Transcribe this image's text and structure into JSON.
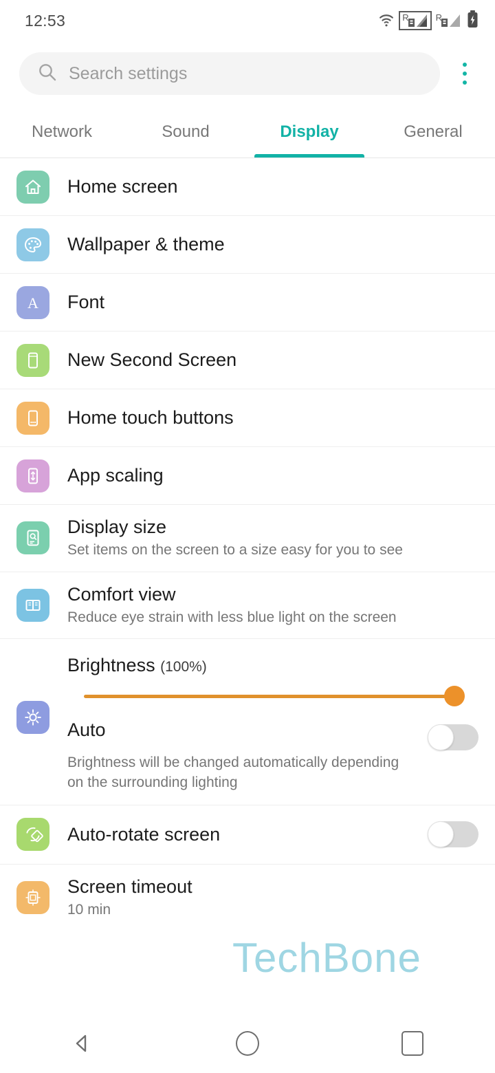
{
  "status_bar": {
    "time": "12:53",
    "icons": [
      "wifi-icon",
      "signal-roaming-sim1-icon",
      "signal-roaming-sim2-icon",
      "battery-charging-icon"
    ],
    "roaming_label": "R"
  },
  "search": {
    "placeholder": "Search settings",
    "icon": "search-icon",
    "overflow_icon": "more-vertical-icon"
  },
  "tabs": [
    {
      "label": "Network",
      "active": false
    },
    {
      "label": "Sound",
      "active": false
    },
    {
      "label": "Display",
      "active": true
    },
    {
      "label": "General",
      "active": false
    }
  ],
  "accent_color": "#12b2a6",
  "slider_color": "#ec912a",
  "settings": [
    {
      "title": "Home screen",
      "subtitle": "",
      "icon": "home-icon",
      "icon_color": "#7ecdaf",
      "control": "none"
    },
    {
      "title": "Wallpaper & theme",
      "subtitle": "",
      "icon": "palette-icon",
      "icon_color": "#8ec9e6",
      "control": "none"
    },
    {
      "title": "Font",
      "subtitle": "",
      "icon": "font-letter-a-icon",
      "icon_color": "#9aa7e0",
      "control": "none"
    },
    {
      "title": "New Second Screen",
      "subtitle": "",
      "icon": "phone-screen-icon",
      "icon_color": "#a8da78",
      "control": "none"
    },
    {
      "title": "Home touch buttons",
      "subtitle": "",
      "icon": "phone-buttons-icon",
      "icon_color": "#f4b868",
      "control": "none"
    },
    {
      "title": "App scaling",
      "subtitle": "",
      "icon": "phone-resize-icon",
      "icon_color": "#d7a3d9",
      "control": "none"
    },
    {
      "title": "Display size",
      "subtitle": "Set items on the screen to a size easy for you to see",
      "icon": "display-size-icon",
      "icon_color": "#7bcfae",
      "control": "none"
    },
    {
      "title": "Comfort view",
      "subtitle": "Reduce eye strain with less blue light on the screen",
      "icon": "book-icon",
      "icon_color": "#7cc3e3",
      "control": "none"
    }
  ],
  "brightness": {
    "label": "Brightness",
    "value_label": "(100%)",
    "value": 100,
    "icon": "brightness-sun-icon",
    "icon_color": "#8e9ce0"
  },
  "auto_brightness": {
    "title": "Auto",
    "subtitle": "Brightness will be changed automatically depending on the surrounding lighting",
    "toggle_state": "off"
  },
  "auto_rotate": {
    "title": "Auto-rotate screen",
    "icon": "rotate-icon",
    "icon_color": "#a8d96e",
    "toggle_state": "off"
  },
  "screen_timeout": {
    "title": "Screen timeout",
    "subtitle": "10 min",
    "icon": "screen-timeout-icon",
    "icon_color": "#f3b96a"
  },
  "watermark": {
    "text": "TechBone"
  },
  "nav_bar": {
    "back": "back-icon",
    "home": "home-circle-icon",
    "recents": "recents-square-icon"
  }
}
